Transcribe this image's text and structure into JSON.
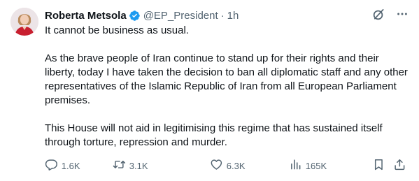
{
  "author": {
    "display_name": "Roberta Metsola",
    "handle": "@EP_President",
    "separator": "·",
    "timestamp": "1h",
    "verified": true,
    "verified_color": "#1d9bf0"
  },
  "tweet": {
    "paragraphs": [
      "It cannot be business as usual.",
      "As the brave people of Iran continue to stand up for their rights and their liberty, today I have taken the decision to ban all diplomatic staff and any other representatives of the Islamic Republic of Iran from all European Parliament premises.",
      "This House will not aid in legitimising this regime that has sustained itself through torture, repression and murder."
    ]
  },
  "actions": {
    "reply": {
      "icon": "reply-icon",
      "count": "1.6K"
    },
    "retweet": {
      "icon": "retweet-icon",
      "count": "3.1K"
    },
    "like": {
      "icon": "heart-icon",
      "count": "6.3K"
    },
    "views": {
      "icon": "views-icon",
      "count": "165K"
    },
    "bookmark": {
      "icon": "bookmark-icon"
    },
    "share": {
      "icon": "share-icon"
    }
  },
  "top_actions": {
    "grok": {
      "icon": "grok-icon"
    },
    "more": {
      "icon": "more-icon"
    }
  },
  "colors": {
    "text": "#0f1419",
    "secondary": "#536471",
    "verified": "#1d9bf0"
  }
}
